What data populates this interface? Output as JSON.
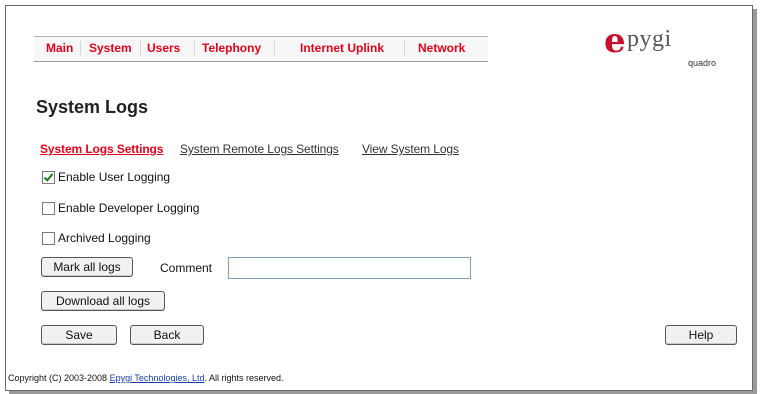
{
  "nav": {
    "items": [
      "Main",
      "System",
      "Users",
      "Telephony",
      "Internet Uplink",
      "Network"
    ]
  },
  "logo": {
    "letter": "e",
    "name": "pygi",
    "product": "quadro"
  },
  "page_title": "System Logs",
  "tabs": [
    {
      "label": "System Logs Settings",
      "active": true
    },
    {
      "label": "System Remote Logs Settings",
      "active": false
    },
    {
      "label": "View System Logs",
      "active": false
    }
  ],
  "options": [
    {
      "label": "Enable User Logging",
      "checked": true
    },
    {
      "label": "Enable Developer Logging",
      "checked": false
    },
    {
      "label": "Archived Logging",
      "checked": false
    }
  ],
  "mark_button": "Mark all logs",
  "comment": {
    "label": "Comment",
    "value": ""
  },
  "download_button": "Download all logs",
  "save_button": "Save",
  "back_button": "Back",
  "help_button": "Help",
  "footer": {
    "prefix": "Copyright (C) 2003-2008 ",
    "link": "Epygi Technologies, Ltd",
    "suffix": ". All rights reserved."
  },
  "colors": {
    "accent": "#e0001a",
    "link": "#1a3ea8"
  }
}
